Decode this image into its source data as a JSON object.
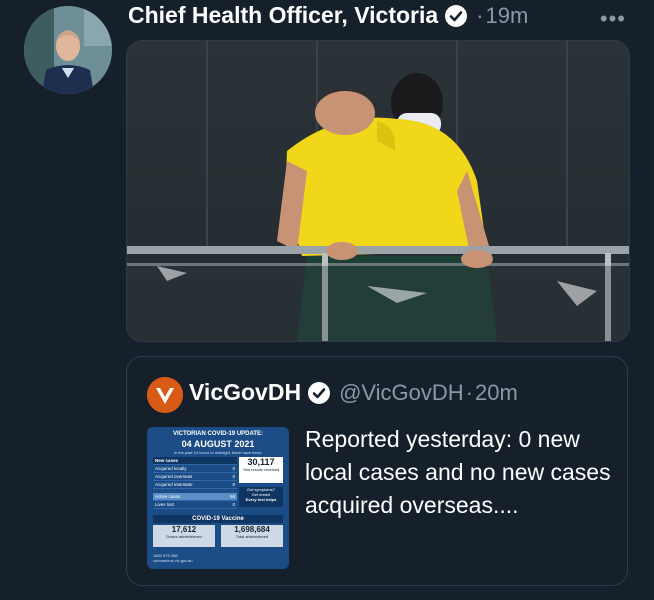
{
  "tweet": {
    "author_name": "Chief Health Officer, Victoria",
    "separator": "·",
    "time": "19m",
    "more_label": "•••",
    "icons": {
      "verified": "verified-badge-icon",
      "more": "more-icon"
    }
  },
  "quoted_tweet": {
    "author_name": "VicGovDH",
    "handle": "@VicGovDH",
    "separator": "·",
    "time": "20m",
    "text": "Reported yesterday: 0 new local cases and no new cases acquired overseas....",
    "image": {
      "title": "VICTORIAN COVID-19 UPDATE:",
      "date": "04 AUGUST 2021",
      "subtitle": "In the past 24 hours to midnight, there have been:",
      "rows": [
        {
          "label": "New cases",
          "value": ""
        },
        {
          "label": "Acquired locally",
          "value": "0"
        },
        {
          "label": "Acquired overseas",
          "value": "0"
        },
        {
          "label": "Acquired interstate",
          "value": "0"
        }
      ],
      "active_cases": {
        "label": "Active cases",
        "value": "66"
      },
      "lives_lost": {
        "label": "Lives lost",
        "value": "0"
      },
      "tests": {
        "value": "30,117",
        "label": "Test results received"
      },
      "symptoms": {
        "line1": "Got symptoms?",
        "line2": "Get tested",
        "line3": "Every test helps"
      },
      "vaccine_title": "COVID-19 Vaccine",
      "doses": {
        "value": "17,612",
        "label": "Doses administered"
      },
      "total": {
        "value": "1,698,684",
        "label": "Total administered"
      },
      "footer_phone": "1800 675 398",
      "footer_site": "coronavirus.vic.gov.au"
    }
  },
  "colors": {
    "background": "#16202b",
    "border": "#2f3b47",
    "secondary_text": "#8b98a5",
    "vic_orange": "#d75a17",
    "shirt_yellow": "#f0d71a"
  }
}
